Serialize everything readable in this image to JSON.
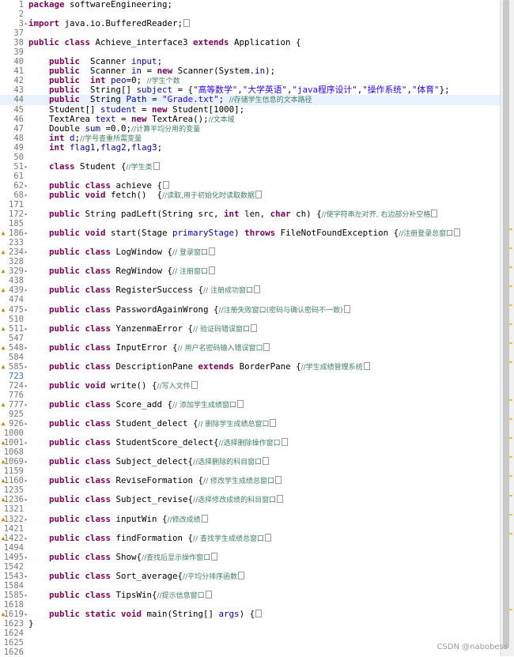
{
  "editor": {
    "lines": [
      {
        "n": "1",
        "segs": [
          [
            "kw",
            "package"
          ],
          [
            "t",
            " softwareEngineering;"
          ]
        ]
      },
      {
        "n": "2",
        "segs": []
      },
      {
        "n": "3",
        "fold": "plus",
        "segs": [
          [
            "kw",
            "import"
          ],
          [
            "t",
            " java.io.BufferedReader;"
          ],
          [
            "box",
            ""
          ]
        ]
      },
      {
        "n": "37",
        "segs": []
      },
      {
        "n": "38",
        "segs": [
          [
            "kw",
            "public class"
          ],
          [
            "t",
            " Achieve_interface3 "
          ],
          [
            "kw",
            "extends"
          ],
          [
            "t",
            " Application {"
          ]
        ]
      },
      {
        "n": "39",
        "segs": []
      },
      {
        "n": "40",
        "segs": [
          [
            "t",
            "    "
          ],
          [
            "kw",
            "public"
          ],
          [
            "t",
            "  Scanner "
          ],
          [
            "fld",
            "input"
          ],
          [
            "t",
            ";"
          ]
        ]
      },
      {
        "n": "41",
        "segs": [
          [
            "t",
            "    "
          ],
          [
            "kw",
            "public"
          ],
          [
            "t",
            "  Scanner "
          ],
          [
            "fld",
            "in"
          ],
          [
            "t",
            " = "
          ],
          [
            "kw",
            "new"
          ],
          [
            "t",
            " Scanner(System."
          ],
          [
            "fld",
            "in"
          ],
          [
            "t",
            ");"
          ]
        ]
      },
      {
        "n": "42",
        "segs": [
          [
            "t",
            "    "
          ],
          [
            "kw",
            "public"
          ],
          [
            "t",
            "  "
          ],
          [
            "kw",
            "int"
          ],
          [
            "t",
            " "
          ],
          [
            "fld",
            "peo"
          ],
          [
            "t",
            "=0; "
          ],
          [
            "cm",
            "//学生个数"
          ]
        ]
      },
      {
        "n": "43",
        "segs": [
          [
            "t",
            "    "
          ],
          [
            "kw",
            "public"
          ],
          [
            "t",
            "  String[] "
          ],
          [
            "fld",
            "subject"
          ],
          [
            "t",
            " = {"
          ],
          [
            "str",
            "\"高等数学\""
          ],
          [
            "t",
            ","
          ],
          [
            "str",
            "\"大学英语\""
          ],
          [
            "t",
            ","
          ],
          [
            "str",
            "\"java程序设计\""
          ],
          [
            "t",
            ","
          ],
          [
            "str",
            "\"操作系统\""
          ],
          [
            "t",
            ","
          ],
          [
            "str",
            "\"体育\""
          ],
          [
            "t",
            "};"
          ]
        ]
      },
      {
        "n": "44",
        "hl": true,
        "segs": [
          [
            "t",
            "    "
          ],
          [
            "kw",
            "public"
          ],
          [
            "t",
            "  String "
          ],
          [
            "fld",
            "Path"
          ],
          [
            "t",
            " = "
          ],
          [
            "str",
            "\"Grade.txt\""
          ],
          [
            "t",
            "; "
          ],
          [
            "cm",
            "//存储学生信息的文本路径"
          ]
        ]
      },
      {
        "n": "45",
        "segs": [
          [
            "t",
            "    Student[] "
          ],
          [
            "fld",
            "student"
          ],
          [
            "t",
            " = "
          ],
          [
            "kw",
            "new"
          ],
          [
            "t",
            " Student[1000];"
          ]
        ]
      },
      {
        "n": "46",
        "segs": [
          [
            "t",
            "    TextArea "
          ],
          [
            "fld",
            "text"
          ],
          [
            "t",
            " = "
          ],
          [
            "kw",
            "new"
          ],
          [
            "t",
            " TextArea();"
          ],
          [
            "cm",
            "//文本域"
          ]
        ]
      },
      {
        "n": "47",
        "segs": [
          [
            "t",
            "    Double "
          ],
          [
            "fld",
            "sum"
          ],
          [
            "t",
            " =0.0;"
          ],
          [
            "cm",
            "//计算平均分用的变量"
          ]
        ]
      },
      {
        "n": "48",
        "segs": [
          [
            "t",
            "    "
          ],
          [
            "kw",
            "int"
          ],
          [
            "t",
            " "
          ],
          [
            "fld",
            "d"
          ],
          [
            "t",
            ";"
          ],
          [
            "cm",
            "//学号查重所需变量"
          ]
        ]
      },
      {
        "n": "49",
        "segs": [
          [
            "t",
            "    "
          ],
          [
            "kw",
            "int"
          ],
          [
            "t",
            " "
          ],
          [
            "fld",
            "flag1"
          ],
          [
            "t",
            ","
          ],
          [
            "fld",
            "flag2"
          ],
          [
            "t",
            ","
          ],
          [
            "fld",
            "flag3"
          ],
          [
            "t",
            ";"
          ]
        ]
      },
      {
        "n": "50",
        "segs": []
      },
      {
        "n": "51",
        "fold": "plus",
        "segs": [
          [
            "t",
            "    "
          ],
          [
            "kw",
            "class"
          ],
          [
            "t",
            " Student {"
          ],
          [
            "cm",
            "//学生类"
          ],
          [
            "box",
            ""
          ]
        ]
      },
      {
        "n": "61",
        "segs": []
      },
      {
        "n": "62",
        "fold": "plus",
        "segs": [
          [
            "t",
            "    "
          ],
          [
            "kw",
            "public class"
          ],
          [
            "t",
            " achieve {"
          ],
          [
            "box",
            ""
          ]
        ]
      },
      {
        "n": "68",
        "fold": "plus",
        "segs": [
          [
            "t",
            "    "
          ],
          [
            "kw",
            "public void"
          ],
          [
            "t",
            " fetch()  {"
          ],
          [
            "cm",
            "//读取,用于初始化时读取数据"
          ],
          [
            "box",
            ""
          ]
        ]
      },
      {
        "n": "171",
        "segs": []
      },
      {
        "n": "172",
        "fold": "plus",
        "segs": [
          [
            "t",
            "    "
          ],
          [
            "kw",
            "public"
          ],
          [
            "t",
            " String padLeft(String src, "
          ],
          [
            "kw",
            "int"
          ],
          [
            "t",
            " len, "
          ],
          [
            "kw",
            "char"
          ],
          [
            "t",
            " ch) {"
          ],
          [
            "cm",
            "//使字符串左对齐, 右边部分补空格"
          ],
          [
            "box",
            ""
          ]
        ]
      },
      {
        "n": "185",
        "segs": []
      },
      {
        "n": "186",
        "mark": true,
        "fold": "plus",
        "segs": [
          [
            "t",
            "    "
          ],
          [
            "kw",
            "public void"
          ],
          [
            "t",
            " start(Stage "
          ],
          [
            "fld",
            "primaryStage"
          ],
          [
            "t",
            ") "
          ],
          [
            "kw",
            "throws"
          ],
          [
            "t",
            " FileNotFoundException {"
          ],
          [
            "cm",
            "//注册登录总窗口"
          ],
          [
            "box",
            ""
          ]
        ]
      },
      {
        "n": "233",
        "segs": []
      },
      {
        "n": "234",
        "mark": true,
        "fold": "plus",
        "segs": [
          [
            "t",
            "    "
          ],
          [
            "kw",
            "public class"
          ],
          [
            "t",
            " LogWindow {"
          ],
          [
            "cm",
            "// 登录窗口"
          ],
          [
            "box",
            ""
          ]
        ]
      },
      {
        "n": "328",
        "segs": []
      },
      {
        "n": "329",
        "mark": true,
        "fold": "plus",
        "segs": [
          [
            "t",
            "    "
          ],
          [
            "kw",
            "public class"
          ],
          [
            "t",
            " RegWindow {"
          ],
          [
            "cm",
            "// 注册窗口"
          ],
          [
            "box",
            ""
          ]
        ]
      },
      {
        "n": "438",
        "segs": []
      },
      {
        "n": "439",
        "mark": true,
        "fold": "plus",
        "segs": [
          [
            "t",
            "    "
          ],
          [
            "kw",
            "public class"
          ],
          [
            "t",
            " RegisterSuccess {"
          ],
          [
            "cm",
            "// 注册成功窗口"
          ],
          [
            "box",
            ""
          ]
        ]
      },
      {
        "n": "474",
        "segs": []
      },
      {
        "n": "475",
        "mark": true,
        "fold": "plus",
        "segs": [
          [
            "t",
            "    "
          ],
          [
            "kw",
            "public class"
          ],
          [
            "t",
            " PasswordAgainWrong {"
          ],
          [
            "cm",
            "//注册失败窗口(密码与确认密码不一致)"
          ],
          [
            "box",
            ""
          ]
        ]
      },
      {
        "n": "510",
        "segs": []
      },
      {
        "n": "511",
        "mark": true,
        "fold": "plus",
        "segs": [
          [
            "t",
            "    "
          ],
          [
            "kw",
            "public class"
          ],
          [
            "t",
            " YanzenmaError {"
          ],
          [
            "cm",
            "// 验证码错误窗口"
          ],
          [
            "box",
            ""
          ]
        ]
      },
      {
        "n": "547",
        "segs": []
      },
      {
        "n": "548",
        "mark": true,
        "fold": "plus",
        "segs": [
          [
            "t",
            "    "
          ],
          [
            "kw",
            "public class"
          ],
          [
            "t",
            " InputError {"
          ],
          [
            "cm",
            "// 用户名密码输入错误窗口"
          ],
          [
            "box",
            ""
          ]
        ]
      },
      {
        "n": "584",
        "segs": []
      },
      {
        "n": "585",
        "mark": true,
        "fold": "plus",
        "segs": [
          [
            "t",
            "    "
          ],
          [
            "kw",
            "public class"
          ],
          [
            "t",
            " DescriptionPane "
          ],
          [
            "kw",
            "extends"
          ],
          [
            "t",
            " BorderPane {"
          ],
          [
            "cm",
            "//学生成绩管理系统"
          ],
          [
            "box",
            ""
          ]
        ]
      },
      {
        "n": "723",
        "sel": true,
        "segs": []
      },
      {
        "n": "724",
        "fold": "plus",
        "segs": [
          [
            "t",
            "    "
          ],
          [
            "kw",
            "public void"
          ],
          [
            "t",
            " write() {"
          ],
          [
            "cm",
            "//写入文件"
          ],
          [
            "box",
            ""
          ]
        ]
      },
      {
        "n": "776",
        "segs": []
      },
      {
        "n": "777",
        "mark": true,
        "fold": "plus",
        "segs": [
          [
            "t",
            "    "
          ],
          [
            "kw",
            "public class"
          ],
          [
            "t",
            " Score_add {"
          ],
          [
            "cm",
            "// 添加学生成绩窗口"
          ],
          [
            "box",
            ""
          ]
        ]
      },
      {
        "n": "925",
        "segs": []
      },
      {
        "n": "926",
        "mark": true,
        "fold": "plus",
        "segs": [
          [
            "t",
            "    "
          ],
          [
            "kw",
            "public class"
          ],
          [
            "t",
            " Student_delect {"
          ],
          [
            "cm",
            "// 删除学生成绩总窗口"
          ],
          [
            "box",
            ""
          ]
        ]
      },
      {
        "n": "1000",
        "segs": []
      },
      {
        "n": "1001",
        "mark": true,
        "fold": "plus",
        "segs": [
          [
            "t",
            "    "
          ],
          [
            "kw",
            "public class"
          ],
          [
            "t",
            " StudentScore_delect{"
          ],
          [
            "cm",
            "//选择删除操作窗口"
          ],
          [
            "box",
            ""
          ]
        ]
      },
      {
        "n": "1068",
        "segs": []
      },
      {
        "n": "1069",
        "mark": true,
        "fold": "plus",
        "segs": [
          [
            "t",
            "    "
          ],
          [
            "kw",
            "public class"
          ],
          [
            "t",
            " Subject_delect{"
          ],
          [
            "cm",
            "//选择删除的科目窗口"
          ],
          [
            "box",
            ""
          ]
        ]
      },
      {
        "n": "1159",
        "segs": []
      },
      {
        "n": "1160",
        "mark": true,
        "fold": "plus",
        "segs": [
          [
            "t",
            "    "
          ],
          [
            "kw",
            "public class"
          ],
          [
            "t",
            " ReviseFormation {"
          ],
          [
            "cm",
            "// 修改学生成绩总窗口"
          ],
          [
            "box",
            ""
          ]
        ]
      },
      {
        "n": "1235",
        "segs": []
      },
      {
        "n": "1236",
        "mark": true,
        "fold": "plus",
        "segs": [
          [
            "t",
            "    "
          ],
          [
            "kw",
            "public class"
          ],
          [
            "t",
            " Subject_revise{"
          ],
          [
            "cm",
            "//选择修改成绩的科目窗口"
          ],
          [
            "box",
            ""
          ]
        ]
      },
      {
        "n": "1321",
        "segs": []
      },
      {
        "n": "1322",
        "mark": true,
        "fold": "plus",
        "segs": [
          [
            "t",
            "    "
          ],
          [
            "kw",
            "public class"
          ],
          [
            "t",
            " inputWin {"
          ],
          [
            "cm",
            "//修改成绩"
          ],
          [
            "box",
            ""
          ]
        ]
      },
      {
        "n": "1421",
        "segs": []
      },
      {
        "n": "1422",
        "mark": true,
        "fold": "plus",
        "segs": [
          [
            "t",
            "    "
          ],
          [
            "kw",
            "public class"
          ],
          [
            "t",
            " findFormation {"
          ],
          [
            "cm",
            "// 查找学生成绩总窗口"
          ],
          [
            "box",
            ""
          ]
        ]
      },
      {
        "n": "1494",
        "segs": []
      },
      {
        "n": "1495",
        "fold": "plus",
        "segs": [
          [
            "t",
            "    "
          ],
          [
            "kw",
            "public class"
          ],
          [
            "t",
            " Show{"
          ],
          [
            "cm",
            "//查找后显示操作窗口"
          ],
          [
            "box",
            ""
          ]
        ]
      },
      {
        "n": "1542",
        "segs": []
      },
      {
        "n": "1543",
        "fold": "plus",
        "segs": [
          [
            "t",
            "    "
          ],
          [
            "kw",
            "public class"
          ],
          [
            "t",
            " Sort_average{"
          ],
          [
            "cm",
            "//平均分排序函数"
          ],
          [
            "box",
            ""
          ]
        ]
      },
      {
        "n": "1584",
        "segs": []
      },
      {
        "n": "1585",
        "fold": "plus",
        "segs": [
          [
            "t",
            "    "
          ],
          [
            "kw",
            "public class"
          ],
          [
            "t",
            " TipsWin{"
          ],
          [
            "cm",
            "//提示信息窗口"
          ],
          [
            "box",
            ""
          ]
        ]
      },
      {
        "n": "1618",
        "segs": []
      },
      {
        "n": "1619",
        "mark": true,
        "fold": "plus",
        "segs": [
          [
            "t",
            "    "
          ],
          [
            "kw",
            "public static void"
          ],
          [
            "t",
            " main(String[] "
          ],
          [
            "fld",
            "args"
          ],
          [
            "t",
            ") {"
          ],
          [
            "box",
            ""
          ]
        ]
      },
      {
        "n": "1623",
        "segs": [
          [
            "t",
            "}"
          ]
        ]
      },
      {
        "n": "1624",
        "segs": []
      },
      {
        "n": "1625",
        "segs": []
      },
      {
        "n": "1626",
        "segs": []
      }
    ]
  },
  "watermark": "CSDN @nabobess",
  "colors": {
    "keyword": "#7f0055",
    "field": "#0000c0",
    "string": "#2a00ff",
    "comment": "#3f7f5f",
    "line_number": "#787878",
    "current_line": "#e8f2fe"
  }
}
